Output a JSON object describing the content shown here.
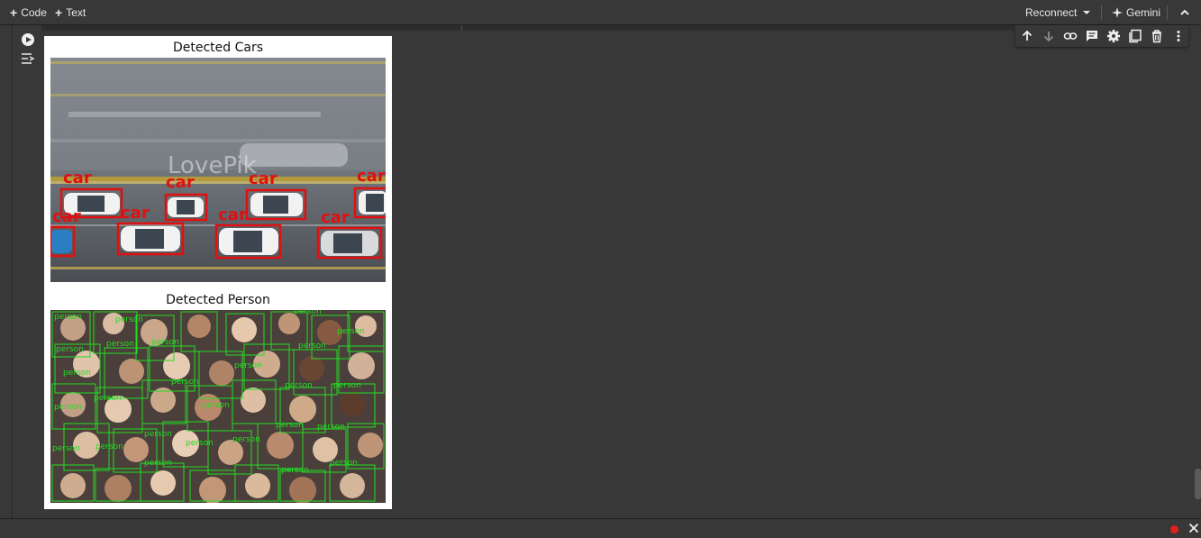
{
  "toolbar": {
    "add_code": "Code",
    "add_text": "Text",
    "reconnect": "Reconnect",
    "gemini": "Gemini"
  },
  "cell_toolbar_icons": [
    "arrow-up-icon",
    "arrow-down-icon",
    "link-icon",
    "comment-icon",
    "gear-icon",
    "mirror-cell-icon",
    "trash-icon",
    "more-vert-icon"
  ],
  "output": {
    "figure1_title": "Detected Cars",
    "figure2_title": "Detected Person",
    "car_label": "car",
    "person_label": "person",
    "watermark": "LovePik"
  },
  "colors": {
    "car_box": "#e01010",
    "person_box": "#22dd22",
    "status_dot": "#e0201c"
  }
}
